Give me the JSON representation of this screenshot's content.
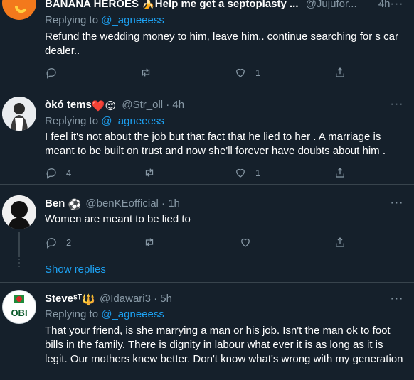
{
  "tweets": [
    {
      "name": "BANANA HEROES 🍌Help me get a septoplasty ...",
      "handle": "@Jujufor...",
      "time": "4h",
      "replying_label": "Replying to",
      "replying_to": "@_agneeess",
      "text": "Refund the wedding money to him, leave him.. continue searching for s car dealer..",
      "replies": "",
      "retweets": "",
      "likes": "1"
    },
    {
      "name": "òkó tems",
      "name_emoji": "❤️😌",
      "handle": "@Str_oll · 4h",
      "replying_label": "Replying to",
      "replying_to": "@_agneeess",
      "text": "I feel it's not about the job but that fact that he lied to her . A marriage is meant to be built on trust and now she'll forever have doubts about him .",
      "replies": "4",
      "retweets": "",
      "likes": "1"
    },
    {
      "name": "Ben",
      "name_emoji": "⚽",
      "handle": "@benKEofficial · 1h",
      "text": "Women are meant to be lied to",
      "replies": "2",
      "retweets": "",
      "likes": ""
    },
    {
      "name": "Steveˢᵀ",
      "name_emoji": "🔱",
      "handle": "@Idawari3 · 5h",
      "replying_label": "Replying to",
      "replying_to": "@_agneeess",
      "text": "That your friend, is she marrying a man or his job. Isn't the man ok to foot bills in the family. There is dignity in labour what ever it is as long as it is legit. Our mothers knew better. Don't know what's wrong with my generation",
      "avatar_text": "OBI"
    }
  ],
  "show_replies": "Show replies",
  "more_glyph": "···",
  "colors": {
    "background": "#15202b",
    "divider": "#38444d",
    "muted": "#8899a6",
    "accent": "#1da1f2",
    "text": "#ffffff"
  },
  "icons": [
    "reply-icon",
    "retweet-icon",
    "like-icon",
    "share-icon",
    "more-icon"
  ]
}
